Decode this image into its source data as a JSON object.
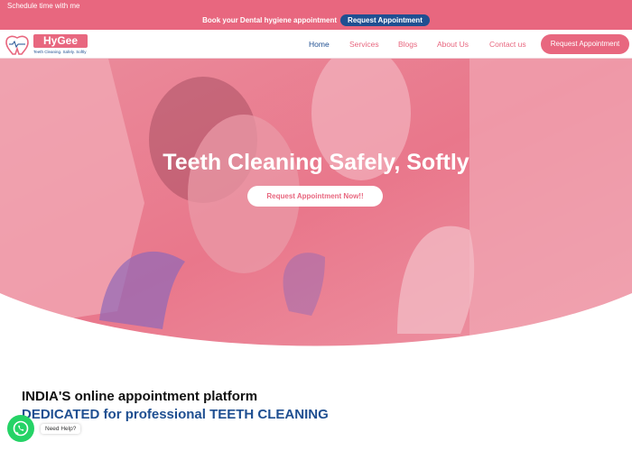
{
  "topbar": {
    "schedule_text": "Schedule time with me",
    "announcement": "Book your Dental hygiene appointment",
    "announcement_button": "Request Appointment"
  },
  "logo": {
    "badge": "HyG",
    "wordmark": "HyGee",
    "tagline": "Teeth Cleaning. Safely. Softly"
  },
  "nav": {
    "items": [
      "Home",
      "Services",
      "Blogs",
      "About Us",
      "Contact us"
    ],
    "cta": "Request Appointment"
  },
  "hero": {
    "title": "Teeth Cleaning Safely, Softly",
    "button": "Request Appointment Now!!"
  },
  "platform": {
    "line1": "INDIA'S online appointment platform",
    "line2": "DEDICATED for professional TEETH CLEANING"
  },
  "whatsapp": {
    "label": "Need Help?"
  },
  "colors": {
    "brand_pink": "#e8677f",
    "brand_blue": "#1f4f91",
    "whatsapp_green": "#25d366"
  }
}
